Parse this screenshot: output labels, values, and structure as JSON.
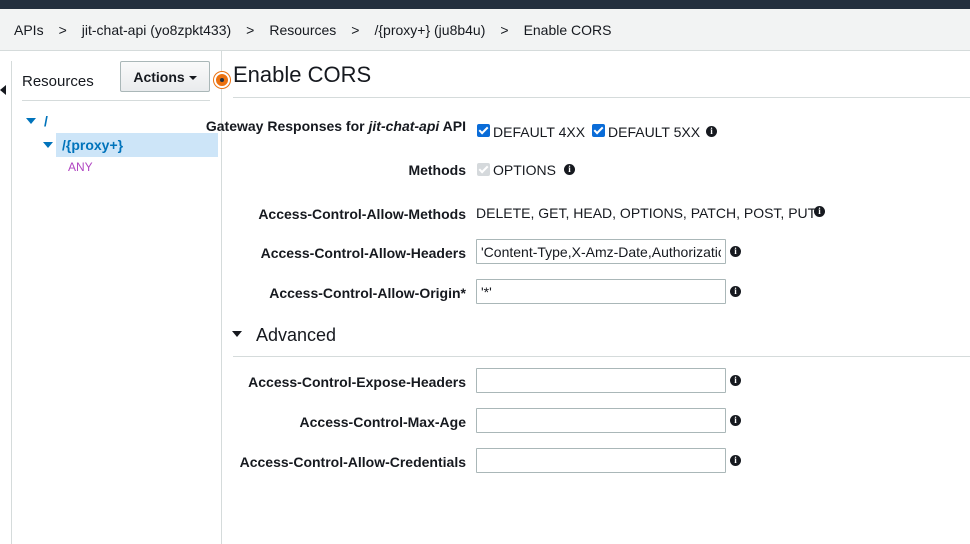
{
  "breadcrumb": {
    "items": [
      "APIs",
      "jit-chat-api (yo8zpkt433)",
      "Resources",
      "/{proxy+} (ju8b4u)",
      "Enable CORS"
    ],
    "separator": ">"
  },
  "sidebar": {
    "title": "Resources",
    "actions_label": "Actions",
    "tree": {
      "root": "/",
      "proxy": "/{proxy+}",
      "method": "ANY"
    }
  },
  "main": {
    "title": "Enable CORS",
    "gateway_responses": {
      "label_prefix": "Gateway Responses for ",
      "label_api": "jit-chat-api",
      "label_suffix": " API",
      "options": [
        {
          "label": "DEFAULT 4XX",
          "checked": true
        },
        {
          "label": "DEFAULT 5XX",
          "checked": true
        }
      ]
    },
    "methods": {
      "label": "Methods",
      "option": "OPTIONS"
    },
    "allow_methods": {
      "label": "Access-Control-Allow-Methods",
      "value": "DELETE, GET, HEAD, OPTIONS, PATCH, POST, PUT"
    },
    "allow_headers": {
      "label": "Access-Control-Allow-Headers",
      "value": "'Content-Type,X-Amz-Date,Authorization,X-Api-Key,X-Amz-Security-Token'"
    },
    "allow_origin": {
      "label": "Access-Control-Allow-Origin*",
      "value": "'*'"
    },
    "advanced": {
      "title": "Advanced",
      "expose_headers_label": "Access-Control-Expose-Headers",
      "expose_headers_value": "",
      "max_age_label": "Access-Control-Max-Age",
      "max_age_value": "",
      "allow_credentials_label": "Access-Control-Allow-Credentials",
      "allow_credentials_value": ""
    }
  },
  "colors": {
    "link_blue": "#0073bb",
    "selected_bg": "#cde5f8",
    "method_purple": "#b146c2",
    "status_orange": "#ec7211",
    "checkbox_blue": "#0a6cd8"
  }
}
